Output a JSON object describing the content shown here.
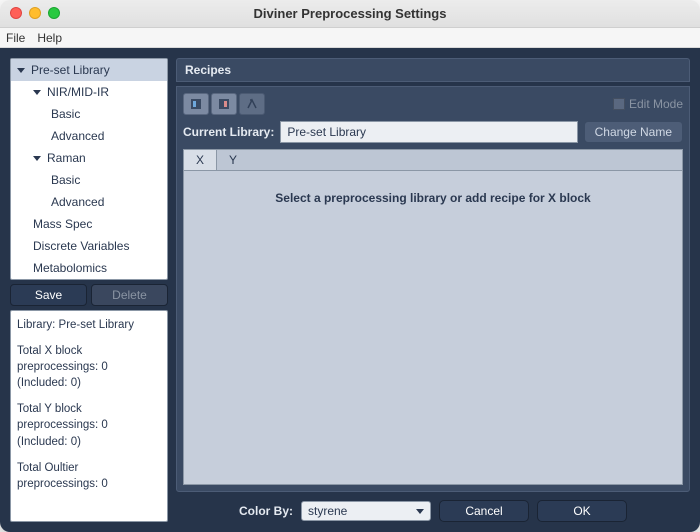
{
  "window": {
    "title": "Diviner Preprocessing Settings"
  },
  "menu": {
    "file": "File",
    "help": "Help"
  },
  "sidebar": {
    "tree": {
      "root": "Pre-set Library",
      "nir": "NIR/MID-IR",
      "nir_basic": "Basic",
      "nir_advanced": "Advanced",
      "raman": "Raman",
      "raman_basic": "Basic",
      "raman_advanced": "Advanced",
      "mass_spec": "Mass Spec",
      "discrete": "Discrete Variables",
      "metabolomics": "Metabolomics"
    },
    "save_label": "Save",
    "delete_label": "Delete",
    "stats": {
      "library": "Library: Pre-set Library",
      "x_block": "Total X block preprocessings: 0 (Included: 0)",
      "y_block": "Total Y block preprocessings: 0 (Included: 0)",
      "outlier": "Total Oultier preprocessings: 0"
    }
  },
  "main": {
    "panel_title": "Recipes",
    "edit_mode": "Edit Mode",
    "current_library_label": "Current Library:",
    "current_library_value": "Pre-set Library",
    "change_name": "Change Name",
    "tab_x": "X",
    "tab_y": "Y",
    "placeholder": "Select a preprocessing library or add recipe for X block"
  },
  "footer": {
    "color_by_label": "Color By:",
    "color_by_value": "styrene",
    "cancel": "Cancel",
    "ok": "OK"
  }
}
